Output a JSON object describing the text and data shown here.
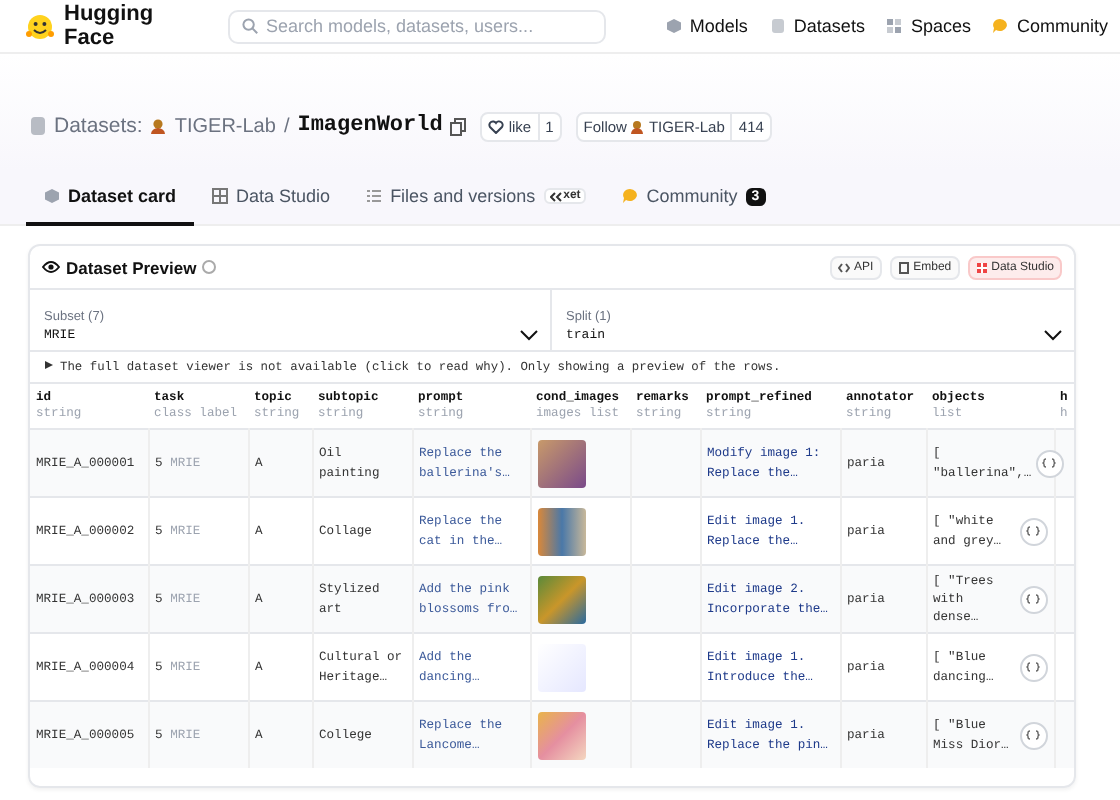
{
  "header": {
    "logo": "Hugging Face",
    "search_placeholder": "Search models, datasets, users...",
    "nav": [
      {
        "label": "Models"
      },
      {
        "label": "Datasets"
      },
      {
        "label": "Spaces"
      },
      {
        "label": "Community"
      }
    ]
  },
  "repo": {
    "type": "Datasets:",
    "owner": "TIGER-Lab",
    "separator": "/",
    "name": "ImagenWorld",
    "like_label": "like",
    "like_count": "1",
    "follow_label": "Follow",
    "follow_owner": "TIGER-Lab",
    "follow_count": "414"
  },
  "tabs": [
    {
      "label": "Dataset card",
      "selected": true
    },
    {
      "label": "Data Studio",
      "selected": false
    },
    {
      "label": "Files and versions",
      "selected": false,
      "badge": "xet"
    },
    {
      "label": "Community",
      "selected": false,
      "badge": "3"
    }
  ],
  "preview": {
    "title": "Dataset Preview",
    "actions": [
      "API",
      "Embed",
      "Data Studio"
    ],
    "subset": {
      "label": "Subset (7)",
      "value": "MRIE"
    },
    "split": {
      "label": "Split (1)",
      "value": "train"
    },
    "notice": "The full dataset viewer is not available (click to read why). Only showing a preview of the rows.",
    "columns": [
      {
        "name": "id",
        "type": "string"
      },
      {
        "name": "task",
        "type": "class label"
      },
      {
        "name": "topic",
        "type": "string"
      },
      {
        "name": "subtopic",
        "type": "string"
      },
      {
        "name": "prompt",
        "type": "string"
      },
      {
        "name": "cond_images",
        "type": "images list"
      },
      {
        "name": "remarks",
        "type": "string"
      },
      {
        "name": "prompt_refined",
        "type": "string"
      },
      {
        "name": "annotator",
        "type": "string"
      },
      {
        "name": "objects",
        "type": "list"
      },
      {
        "name": "h",
        "type": "h"
      }
    ],
    "rows": [
      {
        "id": "MRIE_A_000001",
        "task_num": "5",
        "task_label": "MRIE",
        "topic": "A",
        "subtopic": "Oil painting",
        "prompt": "Replace the ballerina's…",
        "prompt_refined": "Modify image 1: Replace the…",
        "annotator": "paria",
        "objects": "[ \"ballerina\",…"
      },
      {
        "id": "MRIE_A_000002",
        "task_num": "5",
        "task_label": "MRIE",
        "topic": "A",
        "subtopic": "Collage",
        "prompt": "Replace the cat in the…",
        "prompt_refined": "Edit image 1. Replace the…",
        "annotator": "paria",
        "objects": "[ \"white and grey…"
      },
      {
        "id": "MRIE_A_000003",
        "task_num": "5",
        "task_label": "MRIE",
        "topic": "A",
        "subtopic": "Stylized art",
        "prompt": "Add the pink blossoms fro…",
        "prompt_refined": "Edit image 2. Incorporate the…",
        "annotator": "paria",
        "objects": "[ \"Trees with dense…"
      },
      {
        "id": "MRIE_A_000004",
        "task_num": "5",
        "task_label": "MRIE",
        "topic": "A",
        "subtopic": "Cultural or Heritage…",
        "prompt": "Add the dancing…",
        "prompt_refined": "Edit image 1. Introduce the…",
        "annotator": "paria",
        "objects": "[ \"Blue dancing…"
      },
      {
        "id": "MRIE_A_000005",
        "task_num": "5",
        "task_label": "MRIE",
        "topic": "A",
        "subtopic": "College",
        "prompt": "Replace the Lancome…",
        "prompt_refined": "Edit image 1. Replace the pin…",
        "annotator": "paria",
        "objects": "[ \"Blue Miss Dior…"
      }
    ]
  }
}
